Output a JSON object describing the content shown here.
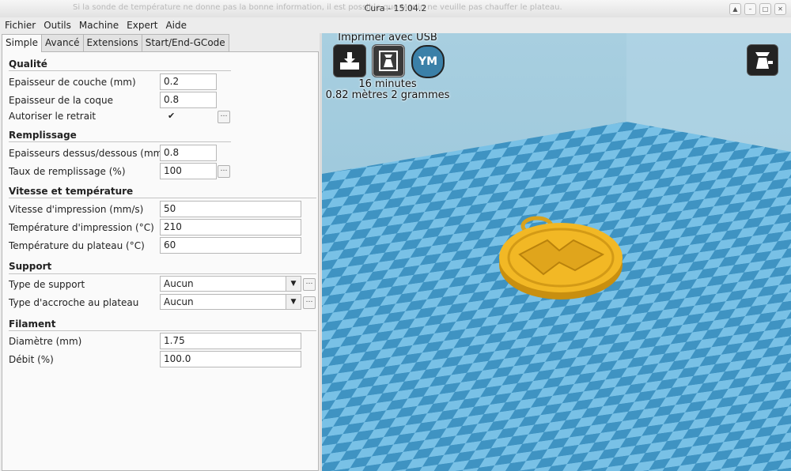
{
  "window": {
    "title": "Cura - 15.04.2",
    "background_notice": "Si la sonde de température ne donne pas la bonne information,   il est possible que Marlin ne veuille pas chauffer le plateau."
  },
  "menubar": [
    "Fichier",
    "Outils",
    "Machine",
    "Expert",
    "Aide"
  ],
  "tabs": [
    "Simple",
    "Avancé",
    "Extensions",
    "Start/End-GCode"
  ],
  "sections": {
    "quality": {
      "title": "Qualité",
      "layer_label": "Epaisseur de couche (mm)",
      "layer_value": "0.2",
      "shell_label": "Epaisseur de la coque",
      "shell_value": "0.8",
      "retract_label": "Autoriser le retrait",
      "retract_checked": true
    },
    "fill": {
      "title": "Remplissage",
      "topbottom_label": "Epaisseurs dessus/dessous (mm)",
      "topbottom_value": "0.8",
      "density_label": "Taux de remplissage (%)",
      "density_value": "100"
    },
    "speed": {
      "title": "Vitesse et température",
      "print_speed_label": "Vitesse d'impression (mm/s)",
      "print_speed_value": "50",
      "print_temp_label": "Température d'impression (°C)",
      "print_temp_value": "210",
      "bed_temp_label": "Température du plateau (°C)",
      "bed_temp_value": "60"
    },
    "support": {
      "title": "Support",
      "type_label": "Type de support",
      "type_value": "Aucun",
      "adhesion_label": "Type d'accroche au plateau",
      "adhesion_value": "Aucun"
    },
    "filament": {
      "title": "Filament",
      "diameter_label": "Diamètre (mm)",
      "diameter_value": "1.75",
      "flow_label": "Débit (%)",
      "flow_value": "100.0"
    }
  },
  "viewport": {
    "print_button_label": "Imprimer avec USB",
    "print_time": "16 minutes",
    "print_usage": "0.82 mètres 2 grammes",
    "ym_label": "YM",
    "colors": {
      "floor_light": "#79c1e6",
      "floor_dark": "#3f93c2",
      "wall": "#9cc8dd",
      "object": "#f2b825"
    }
  },
  "icons": [
    "load-model-icon",
    "print-usb-icon",
    "youmagine-icon",
    "view-mode-icon",
    "dropdown-arrow-icon",
    "ellipsis-icon"
  ]
}
